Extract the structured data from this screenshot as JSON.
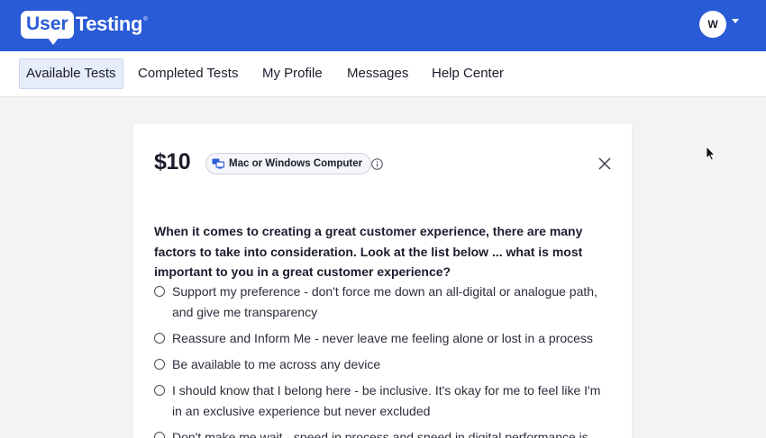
{
  "header": {
    "logo_part1": "User",
    "logo_part2": "Testing",
    "logo_tm": "®",
    "avatar_initial": "W",
    "brand_color": "#2a5bd7"
  },
  "nav": {
    "items": [
      {
        "label": "Available Tests",
        "active": true
      },
      {
        "label": "Completed Tests",
        "active": false
      },
      {
        "label": "My Profile",
        "active": false
      },
      {
        "label": "Messages",
        "active": false
      },
      {
        "label": "Help Center",
        "active": false
      }
    ]
  },
  "test_card": {
    "price": "$10",
    "device": "Mac or Windows Computer",
    "device_icon": "computer-icon",
    "question": "When it comes to creating a great customer experience, there are many factors to take into consideration. Look at the list below ... what is most important to you in a great customer experience?",
    "options": [
      {
        "label": "Support my preference - don't force me down an all-digital or analogue path, and give me transparency"
      },
      {
        "label": "Reassure and Inform Me - never leave me feeling alone or lost in a process"
      },
      {
        "label": "Be available to me across any device"
      },
      {
        "label": "I should know that I belong here - be inclusive. It's okay for me to feel like I'm in an exclusive experience but never excluded"
      },
      {
        "label": "Don't make me wait - speed in process and speed in digital performance is"
      }
    ]
  }
}
